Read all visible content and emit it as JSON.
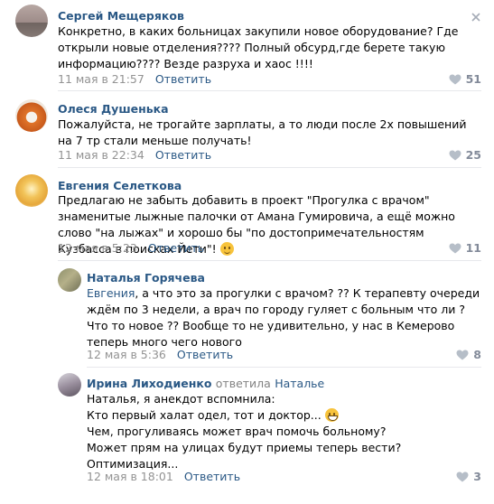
{
  "comments": [
    {
      "author": "Сергей Мещеряков",
      "text": "Конкретно, в каких больницах закупили новое оборудование? Где открыли новые отделения???? Полный обсурд,где берете такую информацию???? Везде разруха и хаос !!!!",
      "date": "11 мая в 21:57",
      "reply_label": "Ответить",
      "likes": "51"
    },
    {
      "author": "Олеся Душенька",
      "text": "Пожалуйста, не трогайте зарплаты, а то люди после 2х повышений на 7 тр стали меньше получать!",
      "date": "11 мая в 22:34",
      "reply_label": "Ответить",
      "likes": "25"
    },
    {
      "author": "Евгения Селеткова",
      "text": "Предлагаю не забыть добавить в проект \"Прогулка с врачом\" знаменитые лыжные палочки от Амана Гумировича, а ещё можно слово \"на лыжах\" и хорошо бы \"по достопримечательностям Кузбасса в поисках Йети\"!",
      "date": "12 мая в 5:23",
      "reply_label": "Ответить",
      "likes": "11"
    },
    {
      "author": "Наталья Горячева",
      "mention": "Евгения",
      "text": ", а что это за прогулки с врачом? ?? К терапевту очереди ждём по 3 недели, а врач по городу гуляет с больным что ли ? Что то новое ?? Вообще то не удивительно, у нас в Кемерово теперь много чего нового",
      "date": "12 мая в 5:36",
      "reply_label": "Ответить",
      "likes": "8"
    },
    {
      "author": "Ирина Лиходиенко",
      "replied_label": "ответила",
      "replied_to": "Наталье",
      "lines": [
        "Наталья, я анекдот вспомнила:",
        "Кто первый халат одел, тот и доктор...",
        "Чем, прогуливаясь может врач помочь больному?",
        "Может прям на улицах будут приемы теперь вести?",
        "Оптимизация..."
      ],
      "date": "12 мая в 18:01",
      "reply_label": "Ответить",
      "likes": "3"
    }
  ]
}
